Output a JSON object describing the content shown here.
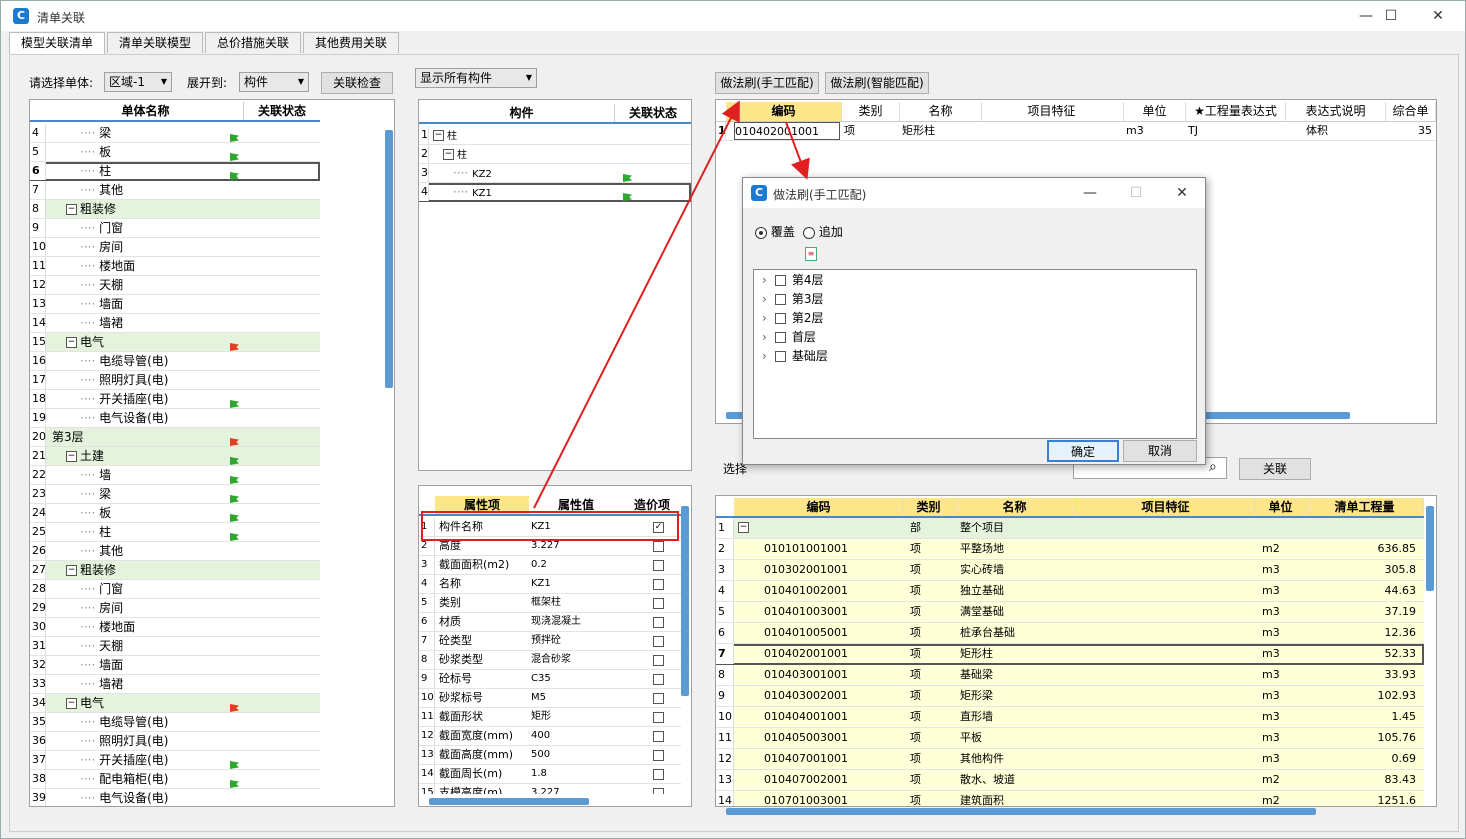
{
  "window": {
    "title": "清单关联",
    "min": "—",
    "max": "☐",
    "close": "✕"
  },
  "tabs": [
    "模型关联清单",
    "清单关联模型",
    "总价措施关联",
    "其他费用关联"
  ],
  "left": {
    "select_unit_label": "请选择单体:",
    "unit_value": "区域-1",
    "expand_label": "展开到:",
    "expand_value": "构件",
    "check_btn": "关联检查",
    "headers": {
      "name": "单体名称",
      "status": "关联状态"
    },
    "rows": [
      {
        "n": "4",
        "text": "梁",
        "lvl": 3,
        "flag": "g"
      },
      {
        "n": "5",
        "text": "板",
        "lvl": 3,
        "flag": "g"
      },
      {
        "n": "6",
        "text": "柱",
        "lvl": 3,
        "flag": "g",
        "sel": true
      },
      {
        "n": "7",
        "text": "其他",
        "lvl": 3
      },
      {
        "n": "8",
        "text": "粗装修",
        "lvl": 2,
        "grp": true
      },
      {
        "n": "9",
        "text": "门窗",
        "lvl": 3
      },
      {
        "n": "10",
        "text": "房间",
        "lvl": 3
      },
      {
        "n": "11",
        "text": "楼地面",
        "lvl": 3
      },
      {
        "n": "12",
        "text": "天棚",
        "lvl": 3
      },
      {
        "n": "13",
        "text": "墙面",
        "lvl": 3
      },
      {
        "n": "14",
        "text": "墙裙",
        "lvl": 3
      },
      {
        "n": "15",
        "text": "电气",
        "lvl": 2,
        "grp": true,
        "flag": "r"
      },
      {
        "n": "16",
        "text": "电缆导管(电)",
        "lvl": 3
      },
      {
        "n": "17",
        "text": "照明灯具(电)",
        "lvl": 3
      },
      {
        "n": "18",
        "text": "开关插座(电)",
        "lvl": 3,
        "flag": "g"
      },
      {
        "n": "19",
        "text": "电气设备(电)",
        "lvl": 3
      },
      {
        "n": "20",
        "text": "第3层",
        "lvl": 1,
        "grp": true,
        "flag": "r"
      },
      {
        "n": "21",
        "text": "土建",
        "lvl": 2,
        "grp": true,
        "flag": "g"
      },
      {
        "n": "22",
        "text": "墙",
        "lvl": 3,
        "flag": "g"
      },
      {
        "n": "23",
        "text": "梁",
        "lvl": 3,
        "flag": "g"
      },
      {
        "n": "24",
        "text": "板",
        "lvl": 3,
        "flag": "g"
      },
      {
        "n": "25",
        "text": "柱",
        "lvl": 3,
        "flag": "g"
      },
      {
        "n": "26",
        "text": "其他",
        "lvl": 3
      },
      {
        "n": "27",
        "text": "粗装修",
        "lvl": 2,
        "grp": true
      },
      {
        "n": "28",
        "text": "门窗",
        "lvl": 3
      },
      {
        "n": "29",
        "text": "房间",
        "lvl": 3
      },
      {
        "n": "30",
        "text": "楼地面",
        "lvl": 3
      },
      {
        "n": "31",
        "text": "天棚",
        "lvl": 3
      },
      {
        "n": "32",
        "text": "墙面",
        "lvl": 3
      },
      {
        "n": "33",
        "text": "墙裙",
        "lvl": 3
      },
      {
        "n": "34",
        "text": "电气",
        "lvl": 2,
        "grp": true,
        "flag": "r"
      },
      {
        "n": "35",
        "text": "电缆导管(电)",
        "lvl": 3
      },
      {
        "n": "36",
        "text": "照明灯具(电)",
        "lvl": 3
      },
      {
        "n": "37",
        "text": "开关插座(电)",
        "lvl": 3,
        "flag": "g"
      },
      {
        "n": "38",
        "text": "配电箱柜(电)",
        "lvl": 3,
        "flag": "g"
      },
      {
        "n": "39",
        "text": "电气设备(电)",
        "lvl": 3
      }
    ]
  },
  "mid": {
    "filter": "显示所有构件",
    "headers": {
      "comp": "构件",
      "status": "关联状态"
    },
    "rows": [
      {
        "n": "1",
        "text": "柱",
        "lvl": 1,
        "exp": true
      },
      {
        "n": "2",
        "text": "柱",
        "lvl": 2,
        "exp": true
      },
      {
        "n": "3",
        "text": "KZ2",
        "lvl": 3,
        "flag": "g"
      },
      {
        "n": "4",
        "text": "KZ1",
        "lvl": 3,
        "flag": "g",
        "sel": true
      }
    ],
    "attr_headers": {
      "name": "属性项",
      "value": "属性值",
      "price": "造价项"
    },
    "attrs": [
      {
        "n": "1",
        "name": "构件名称",
        "value": "KZ1",
        "chk": true
      },
      {
        "n": "2",
        "name": "高度",
        "value": "3.227"
      },
      {
        "n": "3",
        "name": "截面面积(m2)",
        "value": "0.2"
      },
      {
        "n": "4",
        "name": "名称",
        "value": "KZ1"
      },
      {
        "n": "5",
        "name": "类别",
        "value": "框架柱"
      },
      {
        "n": "6",
        "name": "材质",
        "value": "现浇混凝土"
      },
      {
        "n": "7",
        "name": "砼类型",
        "value": "预拌砼"
      },
      {
        "n": "8",
        "name": "砂浆类型",
        "value": "混合砂浆"
      },
      {
        "n": "9",
        "name": "砼标号",
        "value": "C35"
      },
      {
        "n": "10",
        "name": "砂浆标号",
        "value": "M5"
      },
      {
        "n": "11",
        "name": "截面形状",
        "value": "矩形"
      },
      {
        "n": "12",
        "name": "截面宽度(mm)",
        "value": "400"
      },
      {
        "n": "13",
        "name": "截面高度(mm)",
        "value": "500"
      },
      {
        "n": "14",
        "name": "截面周长(m)",
        "value": "1.8"
      },
      {
        "n": "15",
        "name": "支模高度(m)",
        "value": "3.227"
      }
    ]
  },
  "right_top": {
    "btn_manual": "做法刷(手工匹配)",
    "btn_smart": "做法刷(智能匹配)",
    "headers": [
      "编码",
      "类别",
      "名称",
      "项目特征",
      "单位",
      "★工程量表达式",
      "表达式说明",
      "综合单"
    ],
    "row": {
      "n": "1",
      "code": "010402001001",
      "type": "项",
      "name": "矩形柱",
      "feature": "",
      "unit": "m3",
      "expr": "TJ",
      "desc": "体积",
      "price": "35"
    }
  },
  "right_bottom": {
    "select_label": "选择",
    "assoc_btn": "关联",
    "headers": [
      "编码",
      "类别",
      "名称",
      "项目特征",
      "单位",
      "清单工程量"
    ],
    "rows": [
      {
        "n": "1",
        "code": "",
        "type": "部",
        "name": "整个项目",
        "unit": "",
        "qty": "",
        "grp": true
      },
      {
        "n": "2",
        "code": "010101001001",
        "type": "项",
        "name": "平整场地",
        "unit": "m2",
        "qty": "636.85"
      },
      {
        "n": "3",
        "code": "010302001001",
        "type": "项",
        "name": "实心砖墙",
        "unit": "m3",
        "qty": "305.8"
      },
      {
        "n": "4",
        "code": "010401002001",
        "type": "项",
        "name": "独立基础",
        "unit": "m3",
        "qty": "44.63"
      },
      {
        "n": "5",
        "code": "010401003001",
        "type": "项",
        "name": "满堂基础",
        "unit": "m3",
        "qty": "37.19"
      },
      {
        "n": "6",
        "code": "010401005001",
        "type": "项",
        "name": "桩承台基础",
        "unit": "m3",
        "qty": "12.36"
      },
      {
        "n": "7",
        "code": "010402001001",
        "type": "项",
        "name": "矩形柱",
        "unit": "m3",
        "qty": "52.33",
        "sel": true
      },
      {
        "n": "8",
        "code": "010403001001",
        "type": "项",
        "name": "基础梁",
        "unit": "m3",
        "qty": "33.93"
      },
      {
        "n": "9",
        "code": "010403002001",
        "type": "项",
        "name": "矩形梁",
        "unit": "m3",
        "qty": "102.93"
      },
      {
        "n": "10",
        "code": "010404001001",
        "type": "项",
        "name": "直形墙",
        "unit": "m3",
        "qty": "1.45"
      },
      {
        "n": "11",
        "code": "010405003001",
        "type": "项",
        "name": "平板",
        "unit": "m3",
        "qty": "105.76"
      },
      {
        "n": "12",
        "code": "010407001001",
        "type": "项",
        "name": "其他构件",
        "unit": "m3",
        "qty": "0.69"
      },
      {
        "n": "13",
        "code": "010407002001",
        "type": "项",
        "name": "散水、坡道",
        "unit": "m2",
        "qty": "83.43"
      },
      {
        "n": "14",
        "code": "010701003001",
        "type": "项",
        "name": "建筑面积",
        "unit": "m2",
        "qty": "1251.6"
      }
    ]
  },
  "dialog": {
    "title": "做法刷(手工匹配)",
    "opt_cover": "覆盖",
    "opt_append": "追加",
    "floors": [
      "第4层",
      "第3层",
      "第2层",
      "首层",
      "基础层"
    ],
    "ok": "确定",
    "cancel": "取消"
  },
  "colors": {
    "accent": "#4a86c8",
    "green_row": "#e6f3dc",
    "yellow_row": "#ffffd8",
    "red_annot": "#e02020"
  }
}
